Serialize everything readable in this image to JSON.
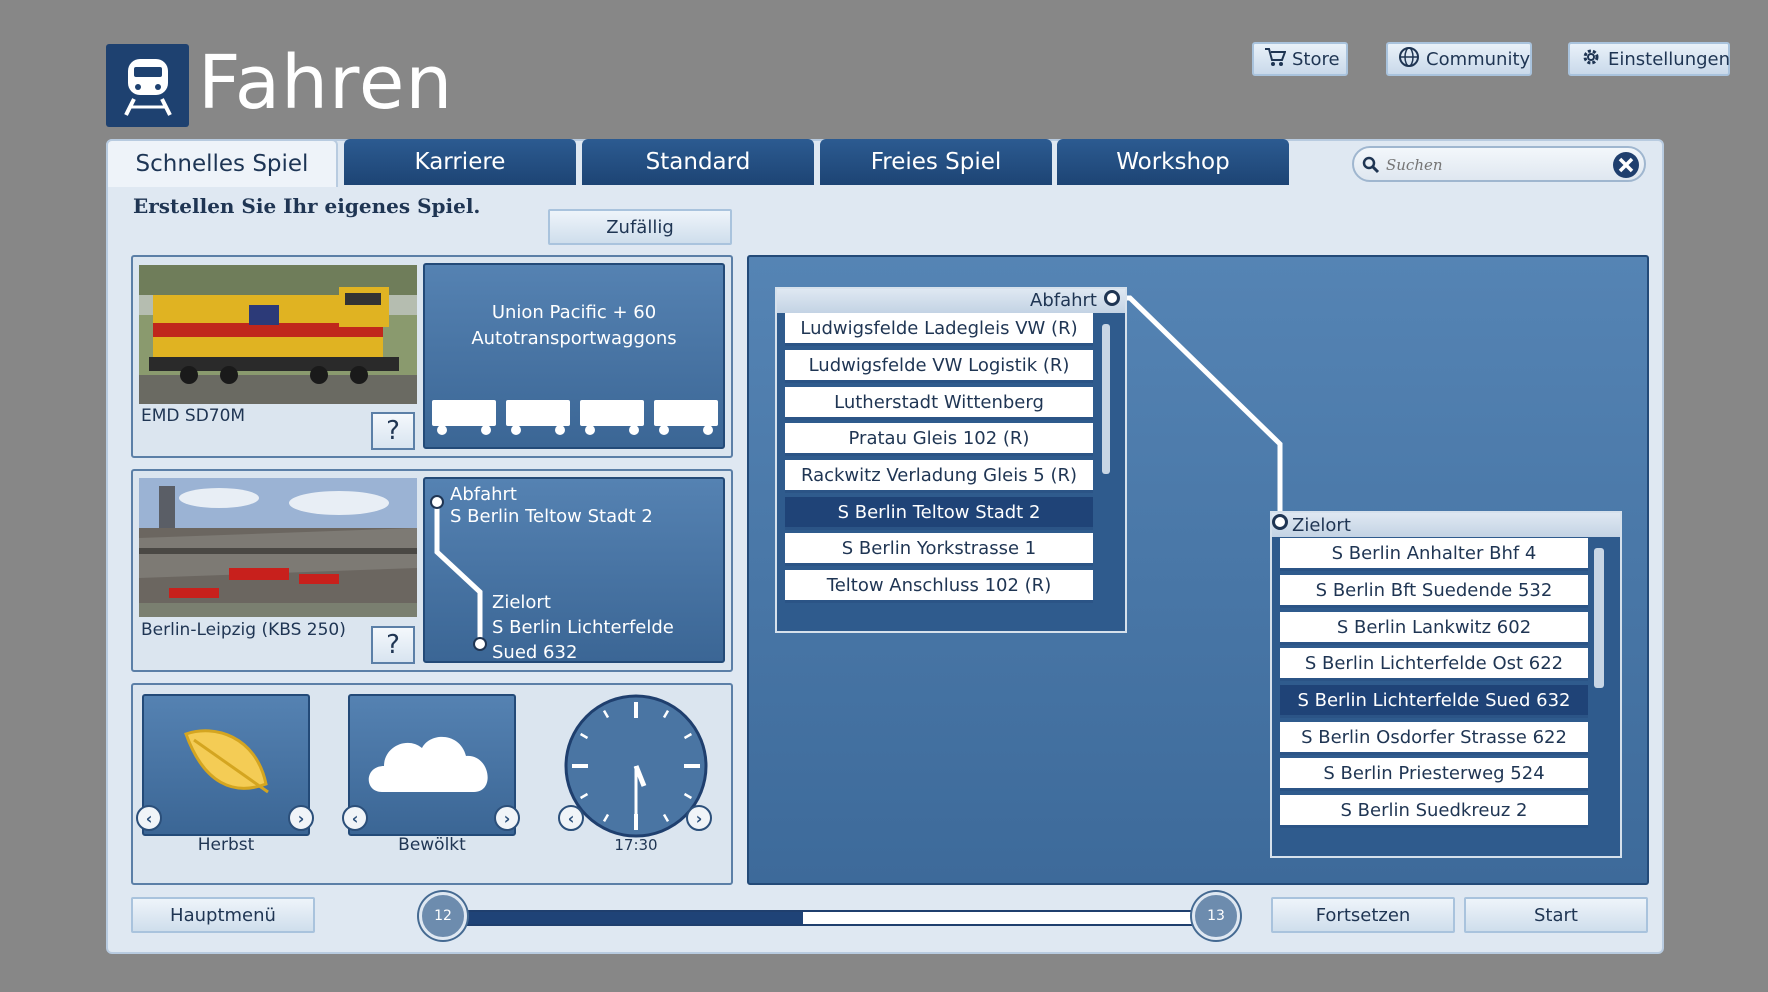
{
  "header": {
    "title": "Fahren",
    "store": "Store",
    "community": "Community",
    "settings": "Einstellungen"
  },
  "tabs": [
    "Schnelles Spiel",
    "Karriere",
    "Standard",
    "Freies Spiel",
    "Workshop"
  ],
  "search": {
    "placeholder": "Suchen"
  },
  "subtitle": "Erstellen Sie Ihr eigenes Spiel.",
  "random_button": "Zufällig",
  "loco": {
    "name": "EMD SD70M",
    "consist": "Union Pacific + 60 Autotransportwaggons",
    "help": "?"
  },
  "route": {
    "name": "Berlin-Leipzig (KBS 250)",
    "help": "?",
    "dep_label": "Abfahrt",
    "dep_value": "S Berlin Teltow Stadt 2",
    "dest_label": "Zielort",
    "dest_value": "S Berlin Lichterfelde Sued 632"
  },
  "conditions": {
    "season": "Herbst",
    "weather": "Bewölkt",
    "time": "17:30"
  },
  "departure_list": {
    "header": "Abfahrt",
    "items": [
      "Ludwigsfelde Ladegleis VW (R)",
      "Ludwigsfelde VW Logistik (R)",
      "Lutherstadt Wittenberg",
      "Pratau Gleis 102 (R)",
      "Rackwitz Verladung Gleis 5 (R)",
      "S Berlin Teltow Stadt 2",
      "S Berlin Yorkstrasse 1",
      "Teltow Anschluss 102 (R)"
    ],
    "selected": "S Berlin Teltow Stadt 2"
  },
  "destination_list": {
    "header": "Zielort",
    "items": [
      "S Berlin Anhalter Bhf 4",
      "S Berlin Bft Suedende 532",
      "S Berlin Lankwitz 602",
      "S Berlin Lichterfelde Ost 622",
      "S Berlin Lichterfelde Sued 632",
      "S Berlin Osdorfer Strasse 622",
      "S Berlin Priesterweg 524",
      "S Berlin Suedkreuz 2"
    ],
    "selected": "S Berlin Lichterfelde Sued 632"
  },
  "footer": {
    "main_menu": "Hauptmenü",
    "continue": "Fortsetzen",
    "start": "Start",
    "level_start": "12",
    "level_end": "13",
    "progress": 0.46
  },
  "colors": {
    "accent": "#1f4377",
    "panel": "#dfe8f2",
    "background": "#878787"
  }
}
